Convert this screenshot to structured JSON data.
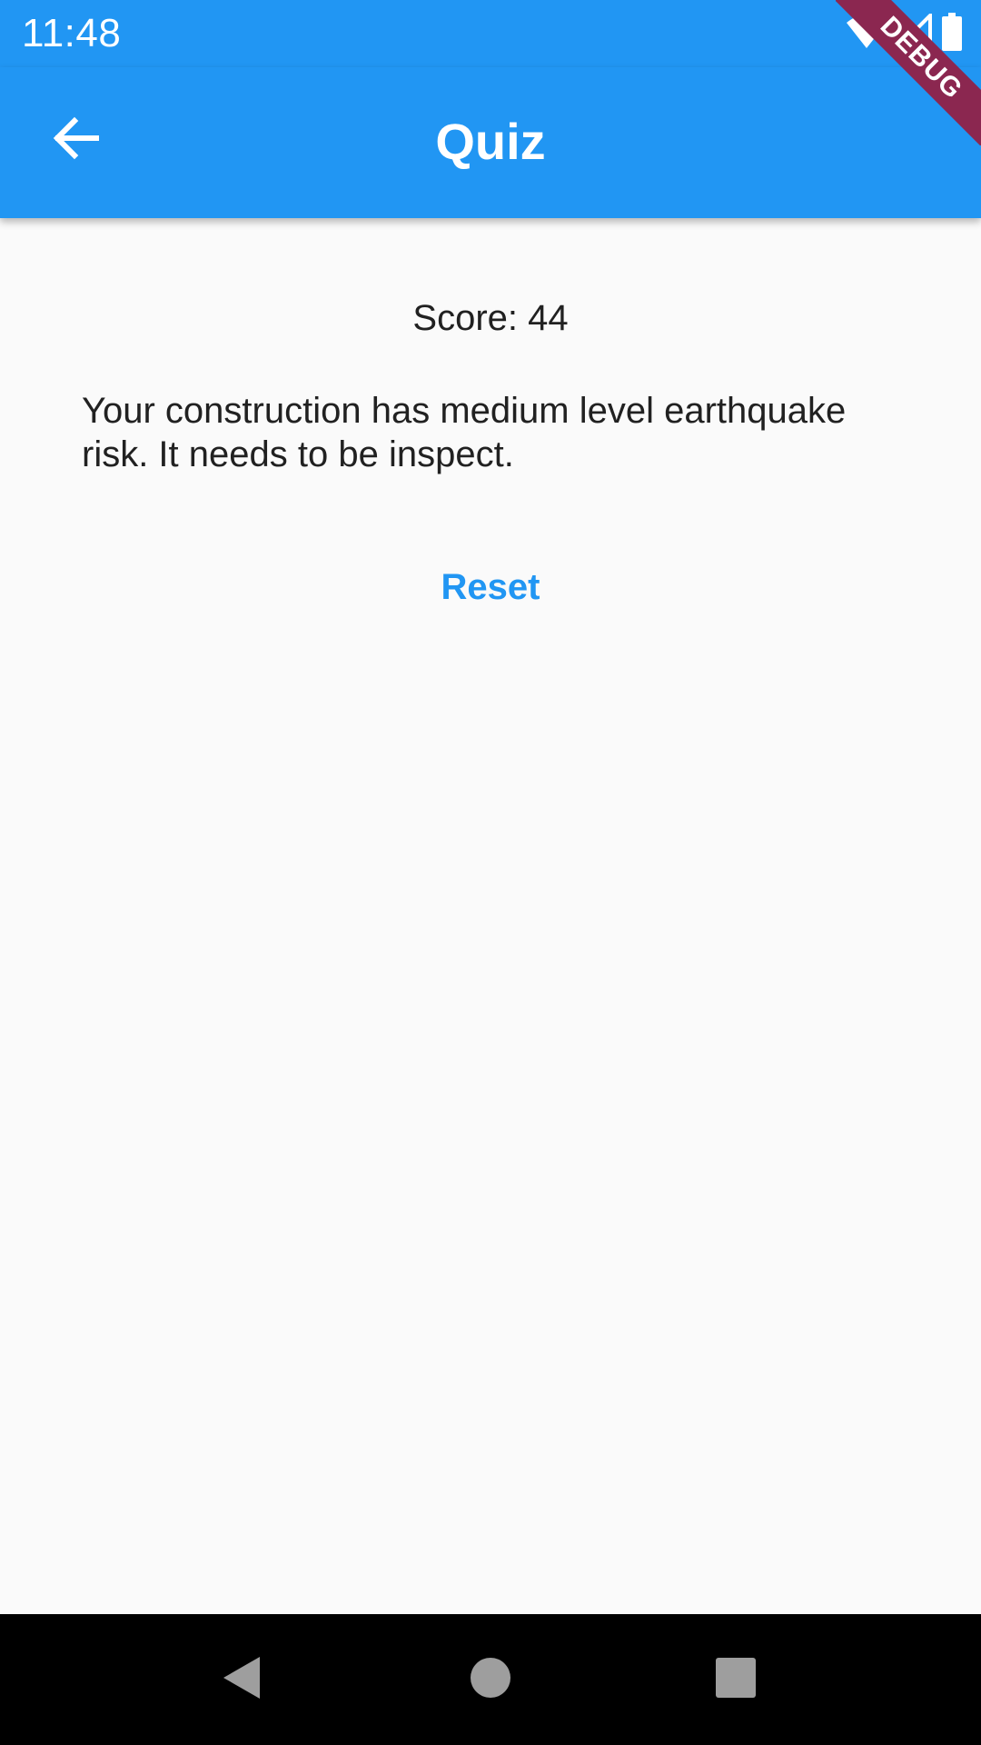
{
  "status_bar": {
    "time": "11:48",
    "icons": [
      "wifi-icon",
      "cell-signal-icon",
      "battery-icon"
    ]
  },
  "app_bar": {
    "title": "Quiz",
    "back_icon": "arrow-back-icon"
  },
  "debug_banner": {
    "label": "DEBUG"
  },
  "content": {
    "score_text": "Score: 44",
    "message": "Your construction has medium level earthquake risk. It needs to be inspect.",
    "reset_label": "Reset"
  },
  "nav_bar": {
    "icons": [
      "back-triangle-icon",
      "home-circle-icon",
      "recents-square-icon"
    ]
  },
  "colors": {
    "primary": "#2196f3",
    "background": "#fafafa",
    "text": "#212121",
    "debug_ribbon": "#8b2750"
  }
}
